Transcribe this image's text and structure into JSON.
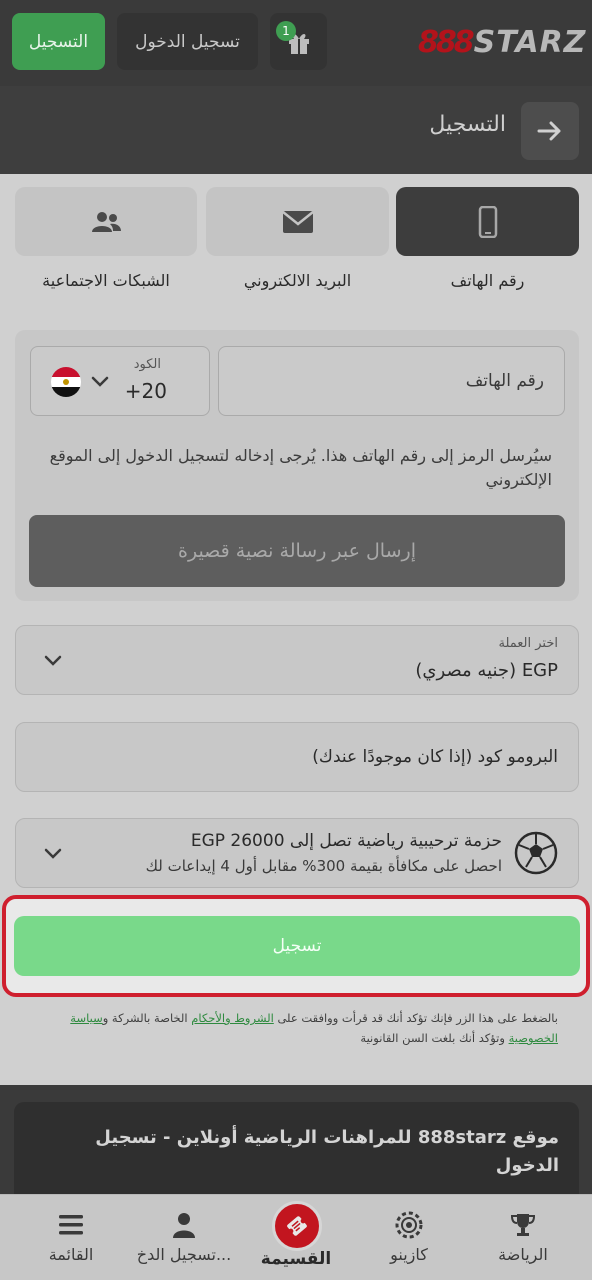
{
  "header": {
    "register_label": "التسجيل",
    "login_label": "تسجيل الدخول",
    "gift_count": "1",
    "logo_prefix": "888",
    "logo_text": "STARZ",
    "brand_red": "#b3131b",
    "accent_green": "#3f9e52"
  },
  "titlebar": {
    "title": "التسجيل"
  },
  "tabs": [
    {
      "label": "رقم الهاتف",
      "icon": "phone-icon",
      "active": true
    },
    {
      "label": "البريد الالكتروني",
      "icon": "envelope-icon",
      "active": false
    },
    {
      "label": "الشبكات الاجتماعية",
      "icon": "users-icon",
      "active": false
    }
  ],
  "phone_form": {
    "phone_placeholder": "رقم الهاتف",
    "code_label": "الكود",
    "code_value": "+20",
    "flag": "egypt-flag-icon",
    "note": "سيُرسل الرمز إلى رقم الهاتف هذا. يُرجى إدخاله لتسجيل الدخول إلى الموقع الإلكتروني",
    "sms_button": "إرسال عبر رسالة نصية قصيرة"
  },
  "currency": {
    "label": "اختر العملة",
    "value": "EGP (جنيه مصري)"
  },
  "promo": {
    "placeholder": "البرومو كود (إذا كان موجودًا عندك)"
  },
  "bonus": {
    "title": "حزمة ترحيبية رياضية تصل إلى EGP 26000",
    "subtitle": "احصل على مكافأة بقيمة 300% مقابل أول 4 إيداعات لك"
  },
  "register_button": "تسجيل",
  "terms": {
    "prefix": "بالضغط على هذا الزر فإنك تؤكد أنك قد قرأت ووافقت على",
    "terms_link": "الشروط والأحكام",
    "middle": "الخاصة بالشركة و",
    "privacy_link": "سياسة الخصوصية",
    "suffix": "وتؤكد أنك بلغت السن القانونية"
  },
  "info": {
    "text": "موقع 888starz للمراهنات الرياضية أونلاين - تسجيل الدخول"
  },
  "bottom_nav": [
    {
      "label": "الرياضة",
      "icon": "trophy-icon"
    },
    {
      "label": "كازينو",
      "icon": "casino-chip-icon"
    },
    {
      "label": "القسيمة",
      "icon": "ticket-icon"
    },
    {
      "label": "تسجيل الدخ...",
      "icon": "user-icon"
    },
    {
      "label": "القائمة",
      "icon": "menu-icon"
    }
  ]
}
